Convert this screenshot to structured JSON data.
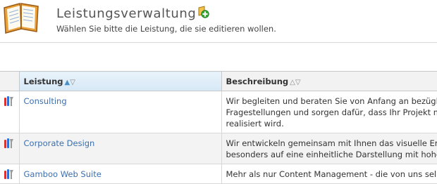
{
  "header": {
    "title": "Leistungsverwaltung",
    "subtitle": "Wählen Sie bitte die Leistung, die sie editieren wollen."
  },
  "table": {
    "columns": [
      {
        "label": "Leistung",
        "sort": "ascending"
      },
      {
        "label": "Beschreibung",
        "sort": "none"
      }
    ],
    "sort_arrows": {
      "asc": "▲",
      "desc": "▽",
      "asc_inactive": "△"
    },
    "rows": [
      {
        "name": "Consulting",
        "description": [
          "Wir begleiten und beraten Sie von Anfang an bezüglich",
          "Fragestellungen und sorgen dafür, dass Ihr Projekt mit",
          "realisiert wird."
        ]
      },
      {
        "name": "Corporate Design",
        "description": [
          "Wir entwickeln gemeinsam mit Ihnen das visuelle Ersc",
          "besonders auf eine einheitliche Darstellung mit hohem"
        ]
      },
      {
        "name": "Gamboo Web Suite",
        "description": [
          "Mehr als nur Content Management - die von uns selbst"
        ]
      }
    ]
  },
  "colors": {
    "link": "#3a6fb0",
    "sorted_header": "#d6e8f6",
    "row_alt": "#f3f3f3"
  }
}
